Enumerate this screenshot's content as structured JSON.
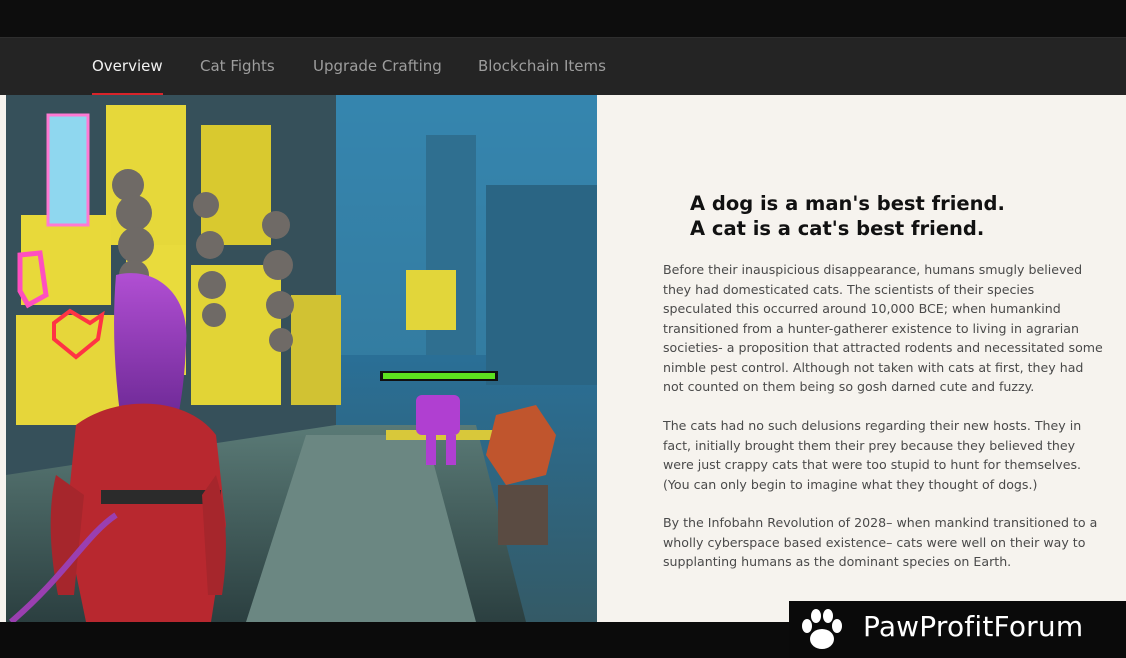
{
  "nav": {
    "tabs": [
      {
        "label": "Overview",
        "active": true
      },
      {
        "label": "Cat Fights",
        "active": false
      },
      {
        "label": "Upgrade Crafting",
        "active": false
      },
      {
        "label": "Blockchain Items",
        "active": false
      }
    ],
    "active_color": "#d8242a"
  },
  "hero": {
    "image_description": "cyberpunk game scene: purple-haired heroine in red armor overlooking neon city catwalk with a purple cat mech and enemy health bar"
  },
  "intro": {
    "headline_line1": "A dog is a man's best friend.",
    "headline_line2": "A cat is a cat's best friend.",
    "paragraphs": [
      "Before their inauspicious disappearance, humans smugly believed they had domesticated cats. The scientists of their species speculated this occurred around 10,000 BCE; when humankind transitioned from a hunter-gatherer existence to living in agrarian societies- a proposition that attracted rodents and necessitated some nimble pest control. Although not taken with cats at first, they had not counted on them being so gosh darned cute and fuzzy.",
      "The cats had no such delusions regarding their new hosts. They in fact, initially brought them their prey because they believed they were just crappy cats that were too stupid to hunt for themselves. (You can only begin to imagine what they thought of dogs.)",
      "By the Infobahn Revolution of 2028– when mankind transitioned to a wholly cyberspace based existence– cats were well on their way to supplanting humans as the dominant species on Earth."
    ]
  },
  "watermark": {
    "text": "PawProfitForum",
    "icon": "paw-icon"
  }
}
